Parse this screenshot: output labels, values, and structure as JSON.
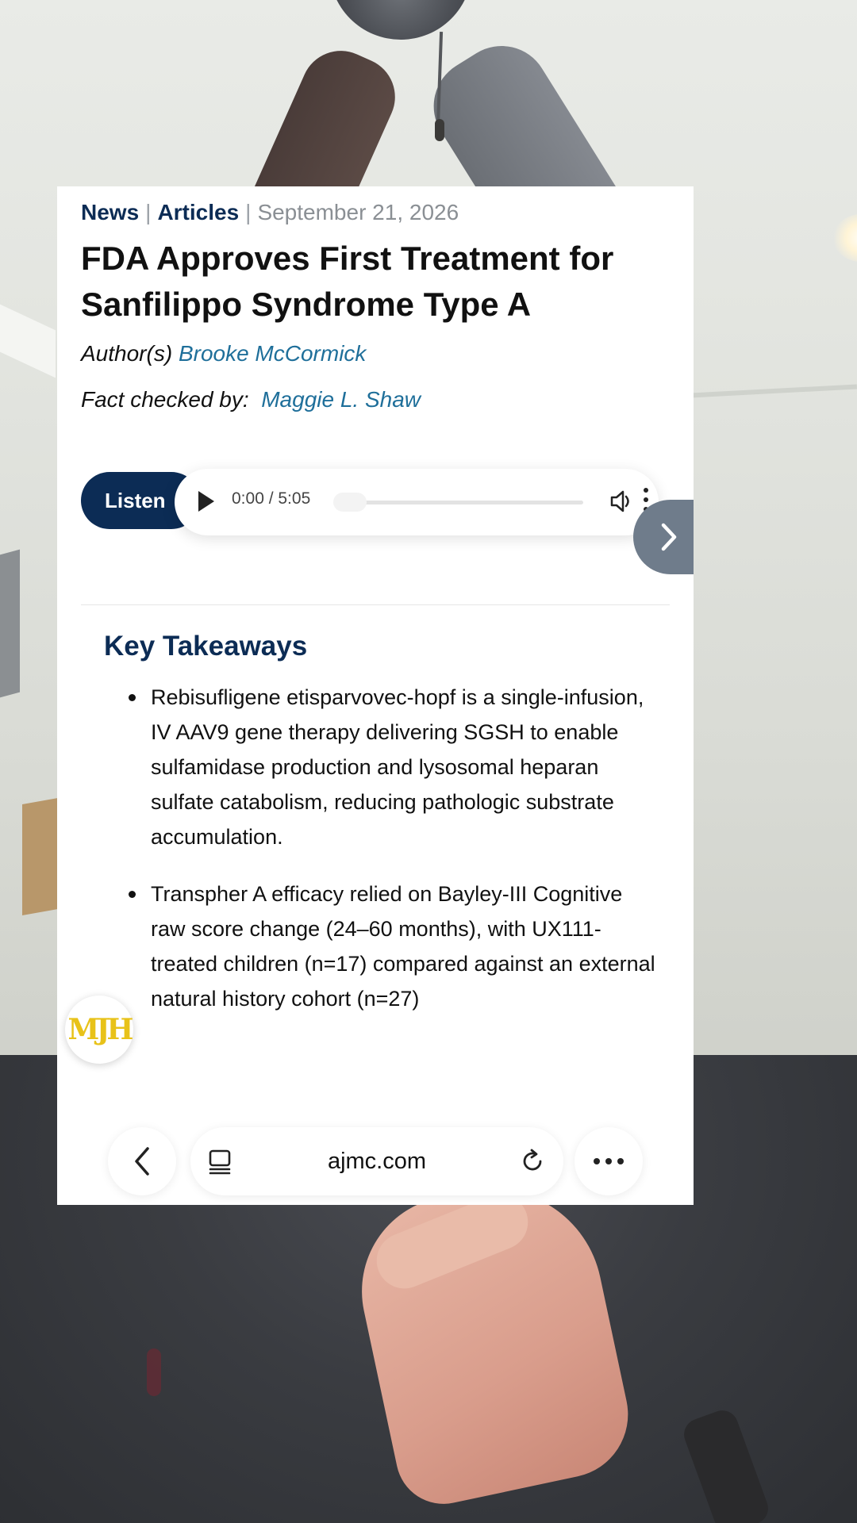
{
  "breadcrumb": {
    "section": "News",
    "category": "Articles",
    "date": "September 21, 2026",
    "separator": "|"
  },
  "article": {
    "title": "FDA Approves First Treatment for Sanfilippo Syndrome Type A",
    "author_label": "Author(s)",
    "author_name": "Brooke McCormick",
    "factcheck_label": "Fact checked by:",
    "factcheck_name": "Maggie L. Shaw"
  },
  "audio": {
    "listen_label": "Listen",
    "time": "0:00 / 5:05",
    "progress": 0
  },
  "takeaways": {
    "heading": "Key Takeaways",
    "items": [
      "Rebisufligene etisparvovec-hopf is a single-infusion, IV AAV9 gene therapy delivering SGSH to enable sulfamidase production and lysosomal heparan sulfate catabolism, reducing pathologic substrate accumulation.",
      "Transpher A efficacy relied on Bayley-III Cognitive raw score change (24–60 months), with UX111-treated children (n=17) compared against an external natural history cohort (n=27)"
    ]
  },
  "brand": {
    "logo_text": "MJH",
    "logo_color": "#e8c219",
    "accent": "#0c2c55",
    "link_color": "#1f6f9a"
  },
  "browser": {
    "url": "ajmc.com"
  },
  "icons": {
    "play": "play-icon",
    "volume": "volume-icon",
    "more": "more-vertical-icon",
    "next": "chevron-right-icon",
    "back": "chevron-left-icon",
    "tabs": "tabs-icon",
    "reload": "reload-icon",
    "menu": "more-horizontal-icon"
  }
}
